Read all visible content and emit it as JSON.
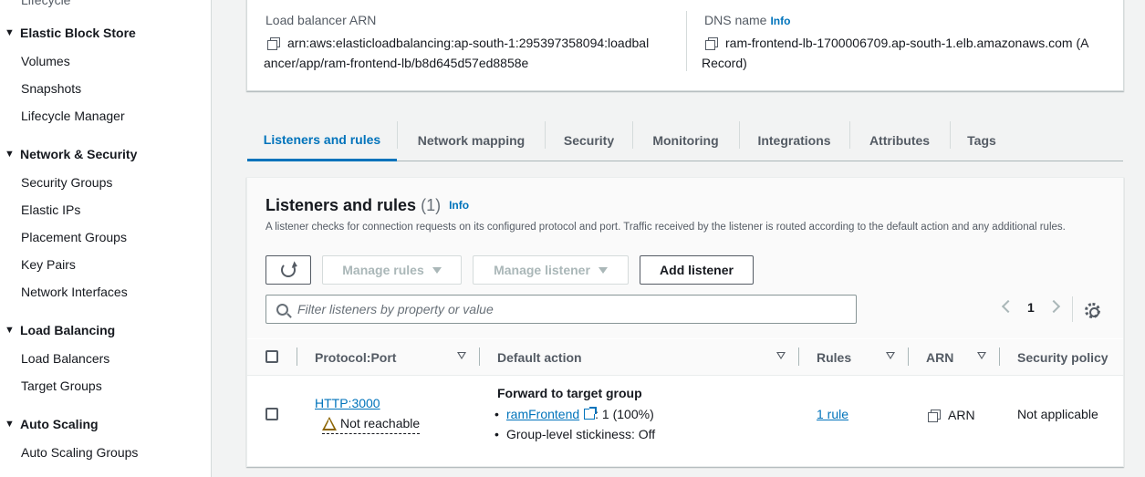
{
  "sidebar": {
    "cut_item": "Lifecycle",
    "sections": [
      {
        "title": "Elastic Block Store",
        "items": [
          "Volumes",
          "Snapshots",
          "Lifecycle Manager"
        ]
      },
      {
        "title": "Network & Security",
        "items": [
          "Security Groups",
          "Elastic IPs",
          "Placement Groups",
          "Key Pairs",
          "Network Interfaces"
        ]
      },
      {
        "title": "Load Balancing",
        "items": [
          "Load Balancers",
          "Target Groups"
        ]
      },
      {
        "title": "Auto Scaling",
        "items": [
          "Auto Scaling Groups"
        ]
      }
    ]
  },
  "details": {
    "arn_label": "Load balancer ARN",
    "arn_line1": "arn:aws:elasticloadbalancing:ap-south-1:295397358094:loadbal",
    "arn_line2": "ancer/app/ram-frontend-lb/b8d645d57ed8858e",
    "dns_label": "DNS name",
    "dns_info": "Info",
    "dns_line1": "ram-frontend-lb-1700006709.ap-south-1.elb.amazonaws.com (A",
    "dns_line2": "Record)"
  },
  "tabs": [
    "Listeners and rules",
    "Network mapping",
    "Security",
    "Monitoring",
    "Integrations",
    "Attributes",
    "Tags"
  ],
  "listeners": {
    "title": "Listeners and rules",
    "count": "(1)",
    "info": "Info",
    "description": "A listener checks for connection requests on its configured protocol and port. Traffic received by the listener is routed according to the default action and any additional rules.",
    "manage_rules": "Manage rules",
    "manage_listener": "Manage listener",
    "add_listener": "Add listener",
    "filter_placeholder": "Filter listeners by property or value",
    "page": "1",
    "columns": [
      "Protocol:Port",
      "Default action",
      "Rules",
      "ARN",
      "Security policy"
    ],
    "row": {
      "protocol_port": "HTTP:3000",
      "status": "Not reachable",
      "action_title": "Forward to target group",
      "target_group": "ramFrontend",
      "target_weight": ": 1 (100%)",
      "stickiness": "Group-level stickiness: Off",
      "rules": "1 rule",
      "arn": "ARN",
      "security_policy": "Not applicable"
    }
  }
}
